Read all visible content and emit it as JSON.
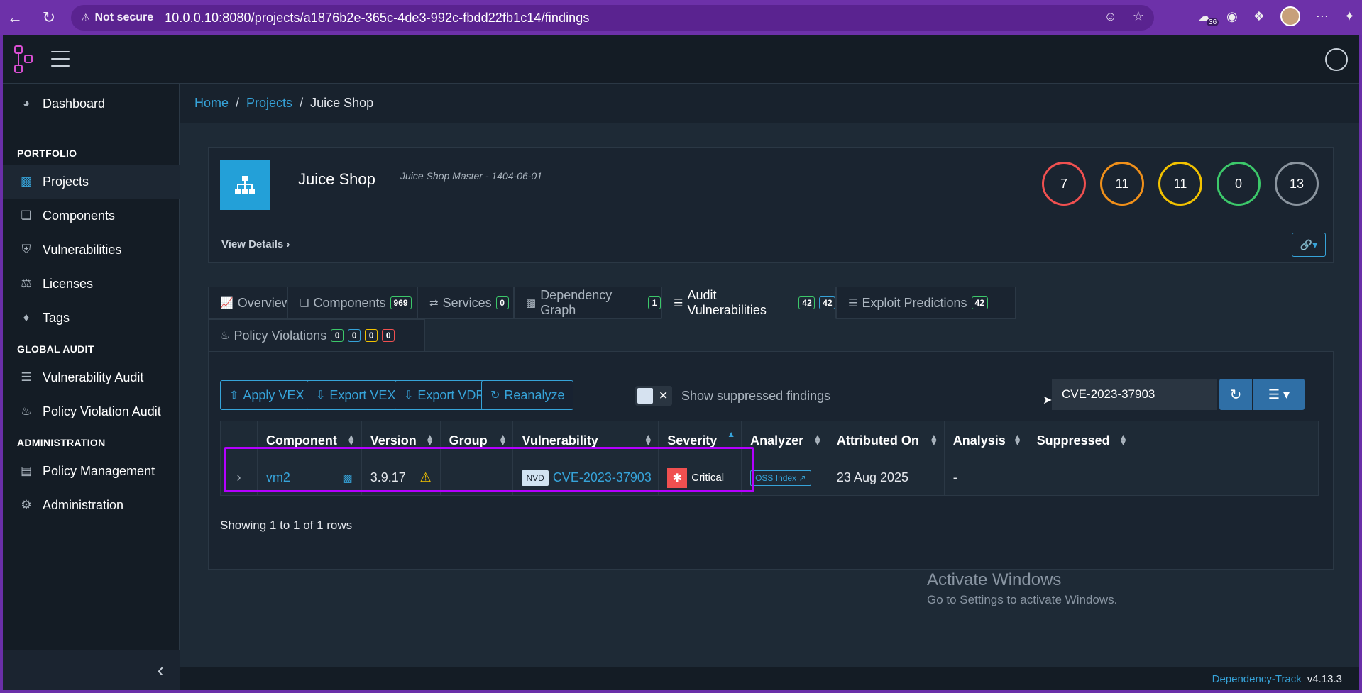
{
  "browser": {
    "not_secure": "Not secure",
    "url": "10.0.0.10:8080/projects/a1876b2e-365c-4de3-992c-fbdd22fb1c14/findings",
    "extension_count": "36"
  },
  "sidebar": {
    "items": [
      {
        "label": "Dashboard",
        "icon": "dashboard-icon"
      },
      {
        "label": "Projects",
        "icon": "sitemap-icon"
      },
      {
        "label": "Components",
        "icon": "cubes-icon"
      },
      {
        "label": "Vulnerabilities",
        "icon": "shield-icon"
      },
      {
        "label": "Licenses",
        "icon": "balance-scale-icon"
      },
      {
        "label": "Tags",
        "icon": "tag-icon"
      },
      {
        "label": "Vulnerability Audit",
        "icon": "tasks-icon"
      },
      {
        "label": "Policy Violation Audit",
        "icon": "fire-icon"
      },
      {
        "label": "Policy Management",
        "icon": "list-icon"
      },
      {
        "label": "Administration",
        "icon": "cogs-icon"
      }
    ],
    "headers": {
      "portfolio": "PORTFOLIO",
      "global_audit": "GLOBAL AUDIT",
      "administration": "ADMINISTRATION"
    }
  },
  "breadcrumb": {
    "home": "Home",
    "projects": "Projects",
    "current": "Juice Shop"
  },
  "project": {
    "name": "Juice Shop",
    "meta": "Juice Shop Master - 1404-06-01",
    "view_details": "View Details",
    "severity_counts": [
      {
        "value": "7",
        "color": "#f05050"
      },
      {
        "value": "11",
        "color": "#f0901a"
      },
      {
        "value": "11",
        "color": "#f2c200"
      },
      {
        "value": "0",
        "color": "#3cc86a"
      },
      {
        "value": "13",
        "color": "#8a949e"
      }
    ]
  },
  "tabs": [
    {
      "label": "Overview",
      "icon": "chart-line-icon"
    },
    {
      "label": "Components",
      "icon": "cubes-icon",
      "badges": [
        "969"
      ]
    },
    {
      "label": "Services",
      "icon": "exchange-icon",
      "badges": [
        "0"
      ]
    },
    {
      "label": "Dependency Graph",
      "icon": "sitemap-icon",
      "badges": [
        "1"
      ]
    },
    {
      "label": "Audit Vulnerabilities",
      "icon": "tasks-icon",
      "badges": [
        "42",
        "42"
      ]
    },
    {
      "label": "Exploit Predictions",
      "icon": "tasks-icon",
      "badges": [
        "42"
      ]
    },
    {
      "label": "Policy Violations",
      "icon": "fire-icon",
      "badges": [
        "0",
        "0",
        "0",
        "0"
      ]
    }
  ],
  "toolbar": {
    "apply_vex": "Apply VEX",
    "export_vex": "Export VEX",
    "export_vdr": "Export VDR",
    "reanalyze": "Reanalyze",
    "show_suppressed": "Show suppressed findings",
    "search_value": "CVE-2023-37903"
  },
  "table": {
    "columns": [
      "Component",
      "Version",
      "Group",
      "Vulnerability",
      "Severity",
      "Analyzer",
      "Attributed On",
      "Analysis",
      "Suppressed"
    ],
    "rows": [
      {
        "component": "vm2",
        "version": "3.9.17",
        "group": "",
        "source": "NVD",
        "vulnerability": "CVE-2023-37903",
        "severity": "Critical",
        "analyzer": "OSS Index",
        "attributed_on": "23 Aug 2025",
        "analysis": "-",
        "suppressed": ""
      }
    ],
    "showing": "Showing 1 to 1 of 1 rows"
  },
  "watermark": {
    "title": "Activate Windows",
    "subtitle": "Go to Settings to activate Windows."
  },
  "footer": {
    "product": "Dependency-Track",
    "version": "v4.13.3"
  }
}
